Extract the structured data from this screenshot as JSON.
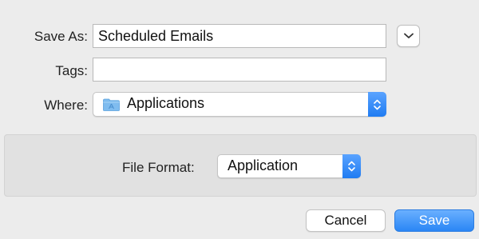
{
  "form": {
    "save_as_label": "Save As:",
    "save_as_value": "Scheduled Emails",
    "tags_label": "Tags:",
    "tags_value": "",
    "where_label": "Where:",
    "where_value": "Applications"
  },
  "format_panel": {
    "file_format_label": "File Format:",
    "file_format_value": "Application"
  },
  "buttons": {
    "cancel_label": "Cancel",
    "save_label": "Save"
  },
  "icons": {
    "expand": "chevron-down-icon",
    "folder": "applications-folder-icon",
    "stepper": "up-down-chevron-icon"
  },
  "colors": {
    "accent": "#2a86f5",
    "background": "#ececec",
    "panel": "#e1e1e1"
  }
}
